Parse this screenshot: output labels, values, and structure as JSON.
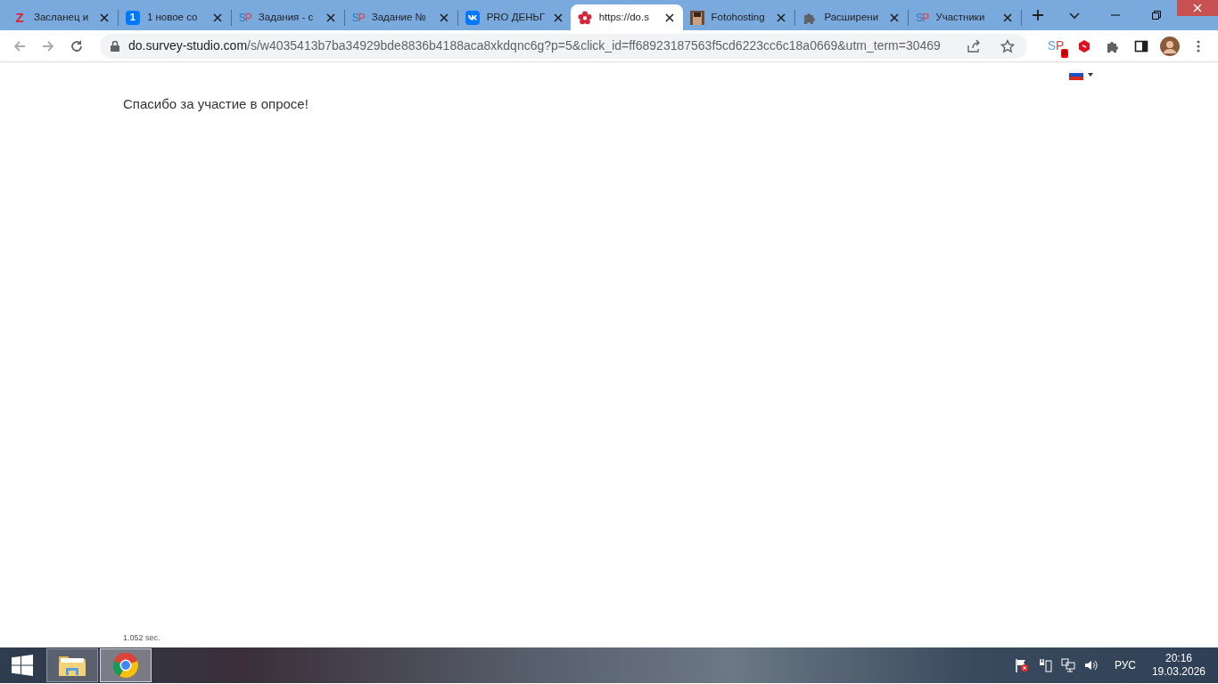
{
  "tabs": [
    {
      "title": "Засланец и",
      "favicon_text": "Z",
      "selected": false
    },
    {
      "title": "1 новое со",
      "favicon_text": "1",
      "selected": false
    },
    {
      "title": "Задания - с",
      "favicon_text": "SP",
      "selected": false
    },
    {
      "title": "Задание №",
      "favicon_text": "SP",
      "selected": false
    },
    {
      "title": "PRO ДЕНЬГ",
      "selected": false
    },
    {
      "title": "https://do.s",
      "selected": true
    },
    {
      "title": "Fotohosting",
      "selected": false
    },
    {
      "title": "Расширени",
      "selected": false
    },
    {
      "title": "Участники",
      "favicon_text": "SP",
      "selected": false
    }
  ],
  "address_bar": {
    "url_host": "do.survey-studio.com",
    "url_path": "/s/w4035413b7ba34929bde8836b4188aca8xkdqnc6g?p=5&click_id=ff68923187563f5cd6223cc6c18a0669&utm_term=30469"
  },
  "extension": {
    "label": "SP",
    "badge": "0"
  },
  "page": {
    "message": "Спасибо за участие в опросе!",
    "timing": "1.052 sec."
  },
  "taskbar": {
    "language": "РУС",
    "time": "20:16",
    "date": "19.03.2026"
  }
}
